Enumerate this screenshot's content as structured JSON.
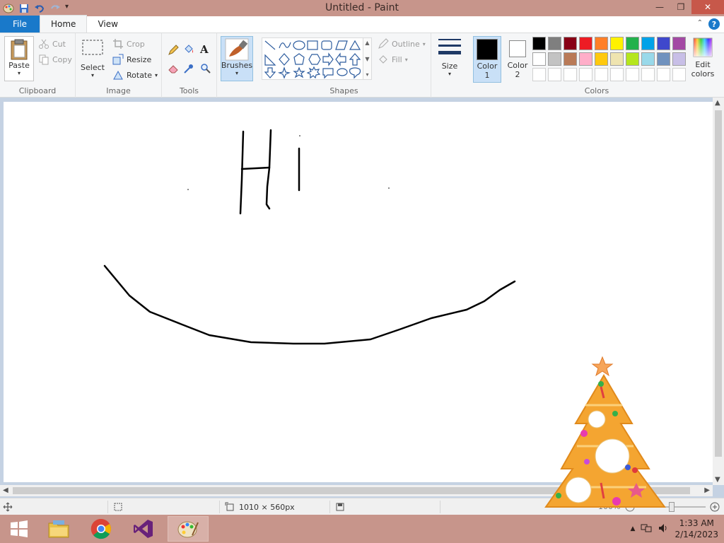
{
  "window": {
    "title": "Untitled - Paint",
    "controls": {
      "minimize": "—",
      "maximize": "❐",
      "close": "✕"
    }
  },
  "tabs": [
    {
      "label": "File"
    },
    {
      "label": "Home"
    },
    {
      "label": "View"
    }
  ],
  "help": "?",
  "ribbon": {
    "clipboard": {
      "group_label": "Clipboard",
      "paste": "Paste",
      "cut": "Cut",
      "copy": "Copy"
    },
    "image": {
      "group_label": "Image",
      "select": "Select",
      "crop": "Crop",
      "resize": "Resize",
      "rotate": "Rotate"
    },
    "tools": {
      "group_label": "Tools"
    },
    "brushes": {
      "label": "Brushes"
    },
    "shapes": {
      "group_label": "Shapes",
      "outline": "Outline",
      "fill": "Fill"
    },
    "size": {
      "label": "Size"
    },
    "colors": {
      "group_label": "Colors",
      "color1": "Color 1",
      "color1_value": "#000000",
      "color2": "Color 2",
      "color2_value": "#ffffff",
      "edit_colors": "Edit colors",
      "palette_row1": [
        "#000000",
        "#7f7f7f",
        "#880015",
        "#ed1c24",
        "#ff7f27",
        "#fff200",
        "#22b14c",
        "#00a2e8",
        "#3f48cc",
        "#a349a4"
      ],
      "palette_row2": [
        "#ffffff",
        "#c3c3c3",
        "#b97a57",
        "#ffaec9",
        "#ffc90e",
        "#efe4b0",
        "#b5e61d",
        "#99d9ea",
        "#7092be",
        "#c8bfe7"
      ]
    }
  },
  "status": {
    "canvas_size": "1010 × 560px",
    "zoom": "100%"
  },
  "taskbar": {
    "apps": [
      "windows-start",
      "file-explorer",
      "chrome",
      "visual-studio",
      "paint"
    ],
    "time": "1:33 AM",
    "date": "2/14/2023"
  }
}
